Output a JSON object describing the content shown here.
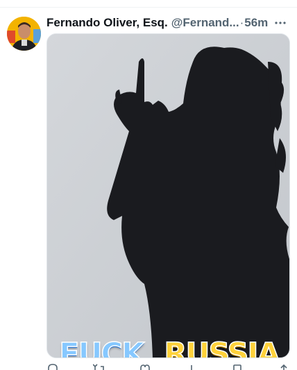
{
  "tweet": {
    "author_name": "Fernando Oliver, Esq.",
    "author_handle": "@Fernand...",
    "separator": "·",
    "timestamp": "56m"
  },
  "media": {
    "overlay_words": [
      "FUCK",
      "RUSSIA"
    ]
  },
  "icons": {
    "more": "more-horizontal-icon",
    "actions": [
      "reply-icon",
      "retweet-icon",
      "like-icon",
      "views-icon",
      "bookmark-icon",
      "share-icon"
    ]
  },
  "colors": {
    "name_text": "#0f1419",
    "secondary_text": "#536471",
    "word_1_fill": "#86c8ff",
    "word_2_fill": "#ffd23a"
  }
}
